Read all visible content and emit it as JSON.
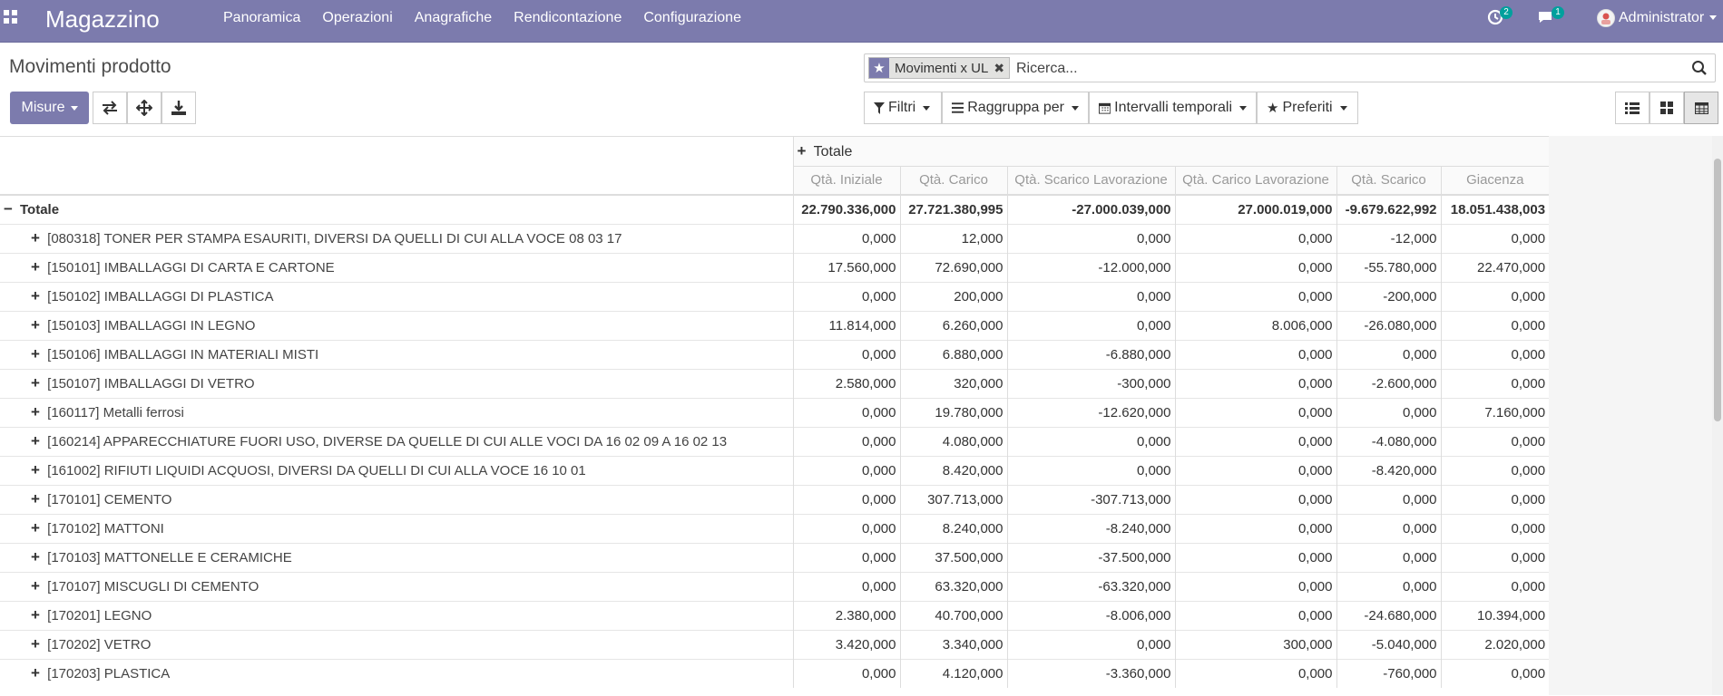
{
  "navbar": {
    "brand": "Magazzino",
    "menu": [
      "Panoramica",
      "Operazioni",
      "Anagrafiche",
      "Rendicontazione",
      "Configurazione"
    ],
    "activity_count": "2",
    "messages_count": "1",
    "user": "Administrator"
  },
  "control_panel": {
    "title": "Movimenti prodotto",
    "search": {
      "facet_label": "Movimenti x UL",
      "placeholder": "Ricerca..."
    },
    "measures_button": "Misure",
    "filters": "Filtri",
    "group_by": "Raggruppa per",
    "time_ranges": "Intervalli temporali",
    "favorites": "Preferiti",
    "icons": {
      "flip": "flip-axis-icon",
      "expand": "expand-all-icon",
      "download": "download-icon",
      "list_view": "list-view-icon",
      "kanban_view": "kanban-view-icon",
      "pivot_view": "pivot-view-icon"
    }
  },
  "pivot": {
    "column_total_label": "Totale",
    "measures": [
      "Qtà. Iniziale",
      "Qtà. Carico",
      "Qtà. Scarico Lavorazione",
      "Qtà. Carico Lavorazione",
      "Qtà. Scarico",
      "Giacenza"
    ],
    "total_row": {
      "label": "Totale",
      "values": [
        "22.790.336,000",
        "27.721.380,995",
        "-27.000.039,000",
        "27.000.019,000",
        "-9.679.622,992",
        "18.051.438,003"
      ]
    },
    "rows": [
      {
        "label": "[080318] TONER PER STAMPA ESAURITI, DIVERSI DA QUELLI DI CUI ALLA VOCE 08 03 17",
        "values": [
          "0,000",
          "12,000",
          "0,000",
          "0,000",
          "-12,000",
          "0,000"
        ]
      },
      {
        "label": "[150101] IMBALLAGGI DI CARTA E CARTONE",
        "values": [
          "17.560,000",
          "72.690,000",
          "-12.000,000",
          "0,000",
          "-55.780,000",
          "22.470,000"
        ]
      },
      {
        "label": "[150102] IMBALLAGGI DI PLASTICA",
        "values": [
          "0,000",
          "200,000",
          "0,000",
          "0,000",
          "-200,000",
          "0,000"
        ]
      },
      {
        "label": "[150103] IMBALLAGGI IN LEGNO",
        "values": [
          "11.814,000",
          "6.260,000",
          "0,000",
          "8.006,000",
          "-26.080,000",
          "0,000"
        ]
      },
      {
        "label": "[150106] IMBALLAGGI IN MATERIALI MISTI",
        "values": [
          "0,000",
          "6.880,000",
          "-6.880,000",
          "0,000",
          "0,000",
          "0,000"
        ]
      },
      {
        "label": "[150107] IMBALLAGGI DI VETRO",
        "values": [
          "2.580,000",
          "320,000",
          "-300,000",
          "0,000",
          "-2.600,000",
          "0,000"
        ]
      },
      {
        "label": "[160117] Metalli ferrosi",
        "values": [
          "0,000",
          "19.780,000",
          "-12.620,000",
          "0,000",
          "0,000",
          "7.160,000"
        ]
      },
      {
        "label": "[160214] APPARECCHIATURE FUORI USO, DIVERSE DA QUELLE DI CUI ALLE VOCI DA 16 02 09 A 16 02 13",
        "values": [
          "0,000",
          "4.080,000",
          "0,000",
          "0,000",
          "-4.080,000",
          "0,000"
        ]
      },
      {
        "label": "[161002] RIFIUTI LIQUIDI ACQUOSI, DIVERSI DA QUELLI DI CUI ALLA VOCE 16 10 01",
        "values": [
          "0,000",
          "8.420,000",
          "0,000",
          "0,000",
          "-8.420,000",
          "0,000"
        ]
      },
      {
        "label": "[170101] CEMENTO",
        "values": [
          "0,000",
          "307.713,000",
          "-307.713,000",
          "0,000",
          "0,000",
          "0,000"
        ]
      },
      {
        "label": "[170102] MATTONI",
        "values": [
          "0,000",
          "8.240,000",
          "-8.240,000",
          "0,000",
          "0,000",
          "0,000"
        ]
      },
      {
        "label": "[170103] MATTONELLE E CERAMICHE",
        "values": [
          "0,000",
          "37.500,000",
          "-37.500,000",
          "0,000",
          "0,000",
          "0,000"
        ]
      },
      {
        "label": "[170107] MISCUGLI DI CEMENTO",
        "values": [
          "0,000",
          "63.320,000",
          "-63.320,000",
          "0,000",
          "0,000",
          "0,000"
        ]
      },
      {
        "label": "[170201] LEGNO",
        "values": [
          "2.380,000",
          "40.700,000",
          "-8.006,000",
          "0,000",
          "-24.680,000",
          "10.394,000"
        ]
      },
      {
        "label": "[170202] VETRO",
        "values": [
          "3.420,000",
          "3.340,000",
          "0,000",
          "300,000",
          "-5.040,000",
          "2.020,000"
        ]
      },
      {
        "label": "[170203] PLASTICA",
        "values": [
          "0,000",
          "4.120,000",
          "-3.360,000",
          "0,000",
          "-760,000",
          "0,000"
        ]
      }
    ]
  }
}
